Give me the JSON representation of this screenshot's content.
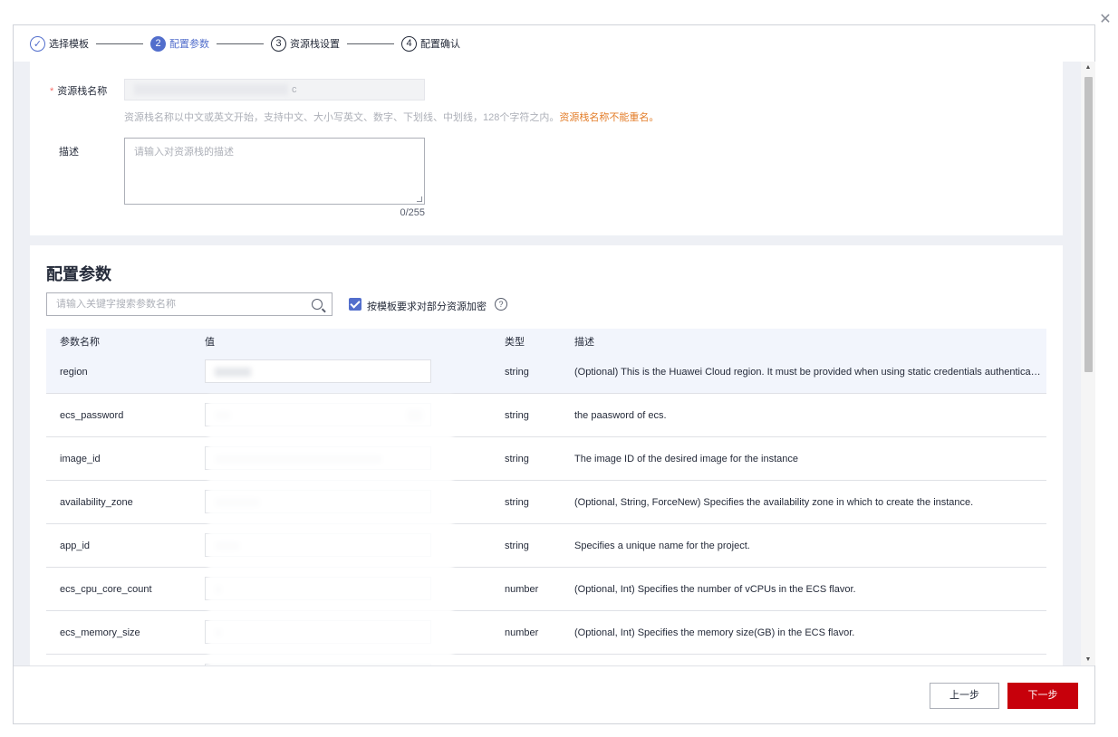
{
  "steps": [
    {
      "num": "✓",
      "label": "选择模板",
      "state": "done"
    },
    {
      "num": "2",
      "label": "配置参数",
      "state": "active"
    },
    {
      "num": "3",
      "label": "资源栈设置",
      "state": "todo"
    },
    {
      "num": "4",
      "label": "配置确认",
      "state": "todo"
    }
  ],
  "basic": {
    "name_required_mark": "*",
    "name_label": "资源栈名称",
    "name_value_tail": "c",
    "name_hint": "资源栈名称以中文或英文开始，支持中文、大小写英文、数字、下划线、中划线，128个字符之内。",
    "name_warning": "资源栈名称不能重名。",
    "desc_label": "描述",
    "desc_placeholder": "请输入对资源栈的描述",
    "desc_counter": "0/255"
  },
  "params": {
    "title": "配置参数",
    "search_placeholder": "请输入关键字搜索参数名称",
    "encrypt_label": "按模板要求对部分资源加密",
    "encrypt_checked": true,
    "columns": {
      "name": "参数名称",
      "value": "值",
      "type": "类型",
      "desc": "描述"
    },
    "rows": [
      {
        "name": "region",
        "type": "string",
        "desc": "(Optional) This is the Huawei Cloud region. It must be provided when using static credentials authentication."
      },
      {
        "name": "ecs_password",
        "type": "string",
        "desc": "the paasword of ecs."
      },
      {
        "name": "image_id",
        "type": "string",
        "desc": "The image ID of the desired image for the instance"
      },
      {
        "name": "availability_zone",
        "type": "string",
        "desc": "(Optional, String, ForceNew) Specifies the availability zone in which to create the instance."
      },
      {
        "name": "app_id",
        "type": "string",
        "desc": "Specifies a unique name for the project."
      },
      {
        "name": "ecs_cpu_core_count",
        "type": "number",
        "desc": "(Optional, Int) Specifies the number of vCPUs in the ECS flavor."
      },
      {
        "name": "ecs_memory_size",
        "type": "number",
        "desc": "(Optional, Int) Specifies the memory size(GB) in the ECS flavor."
      }
    ]
  },
  "footer": {
    "prev_label": "上一步",
    "next_label": "下一步"
  },
  "colors": {
    "accent": "#526ecc",
    "primary_button": "#c7000b",
    "warning": "#e37d29"
  },
  "icons": {
    "close": "close-icon",
    "search": "search-icon",
    "help": "help-icon"
  }
}
